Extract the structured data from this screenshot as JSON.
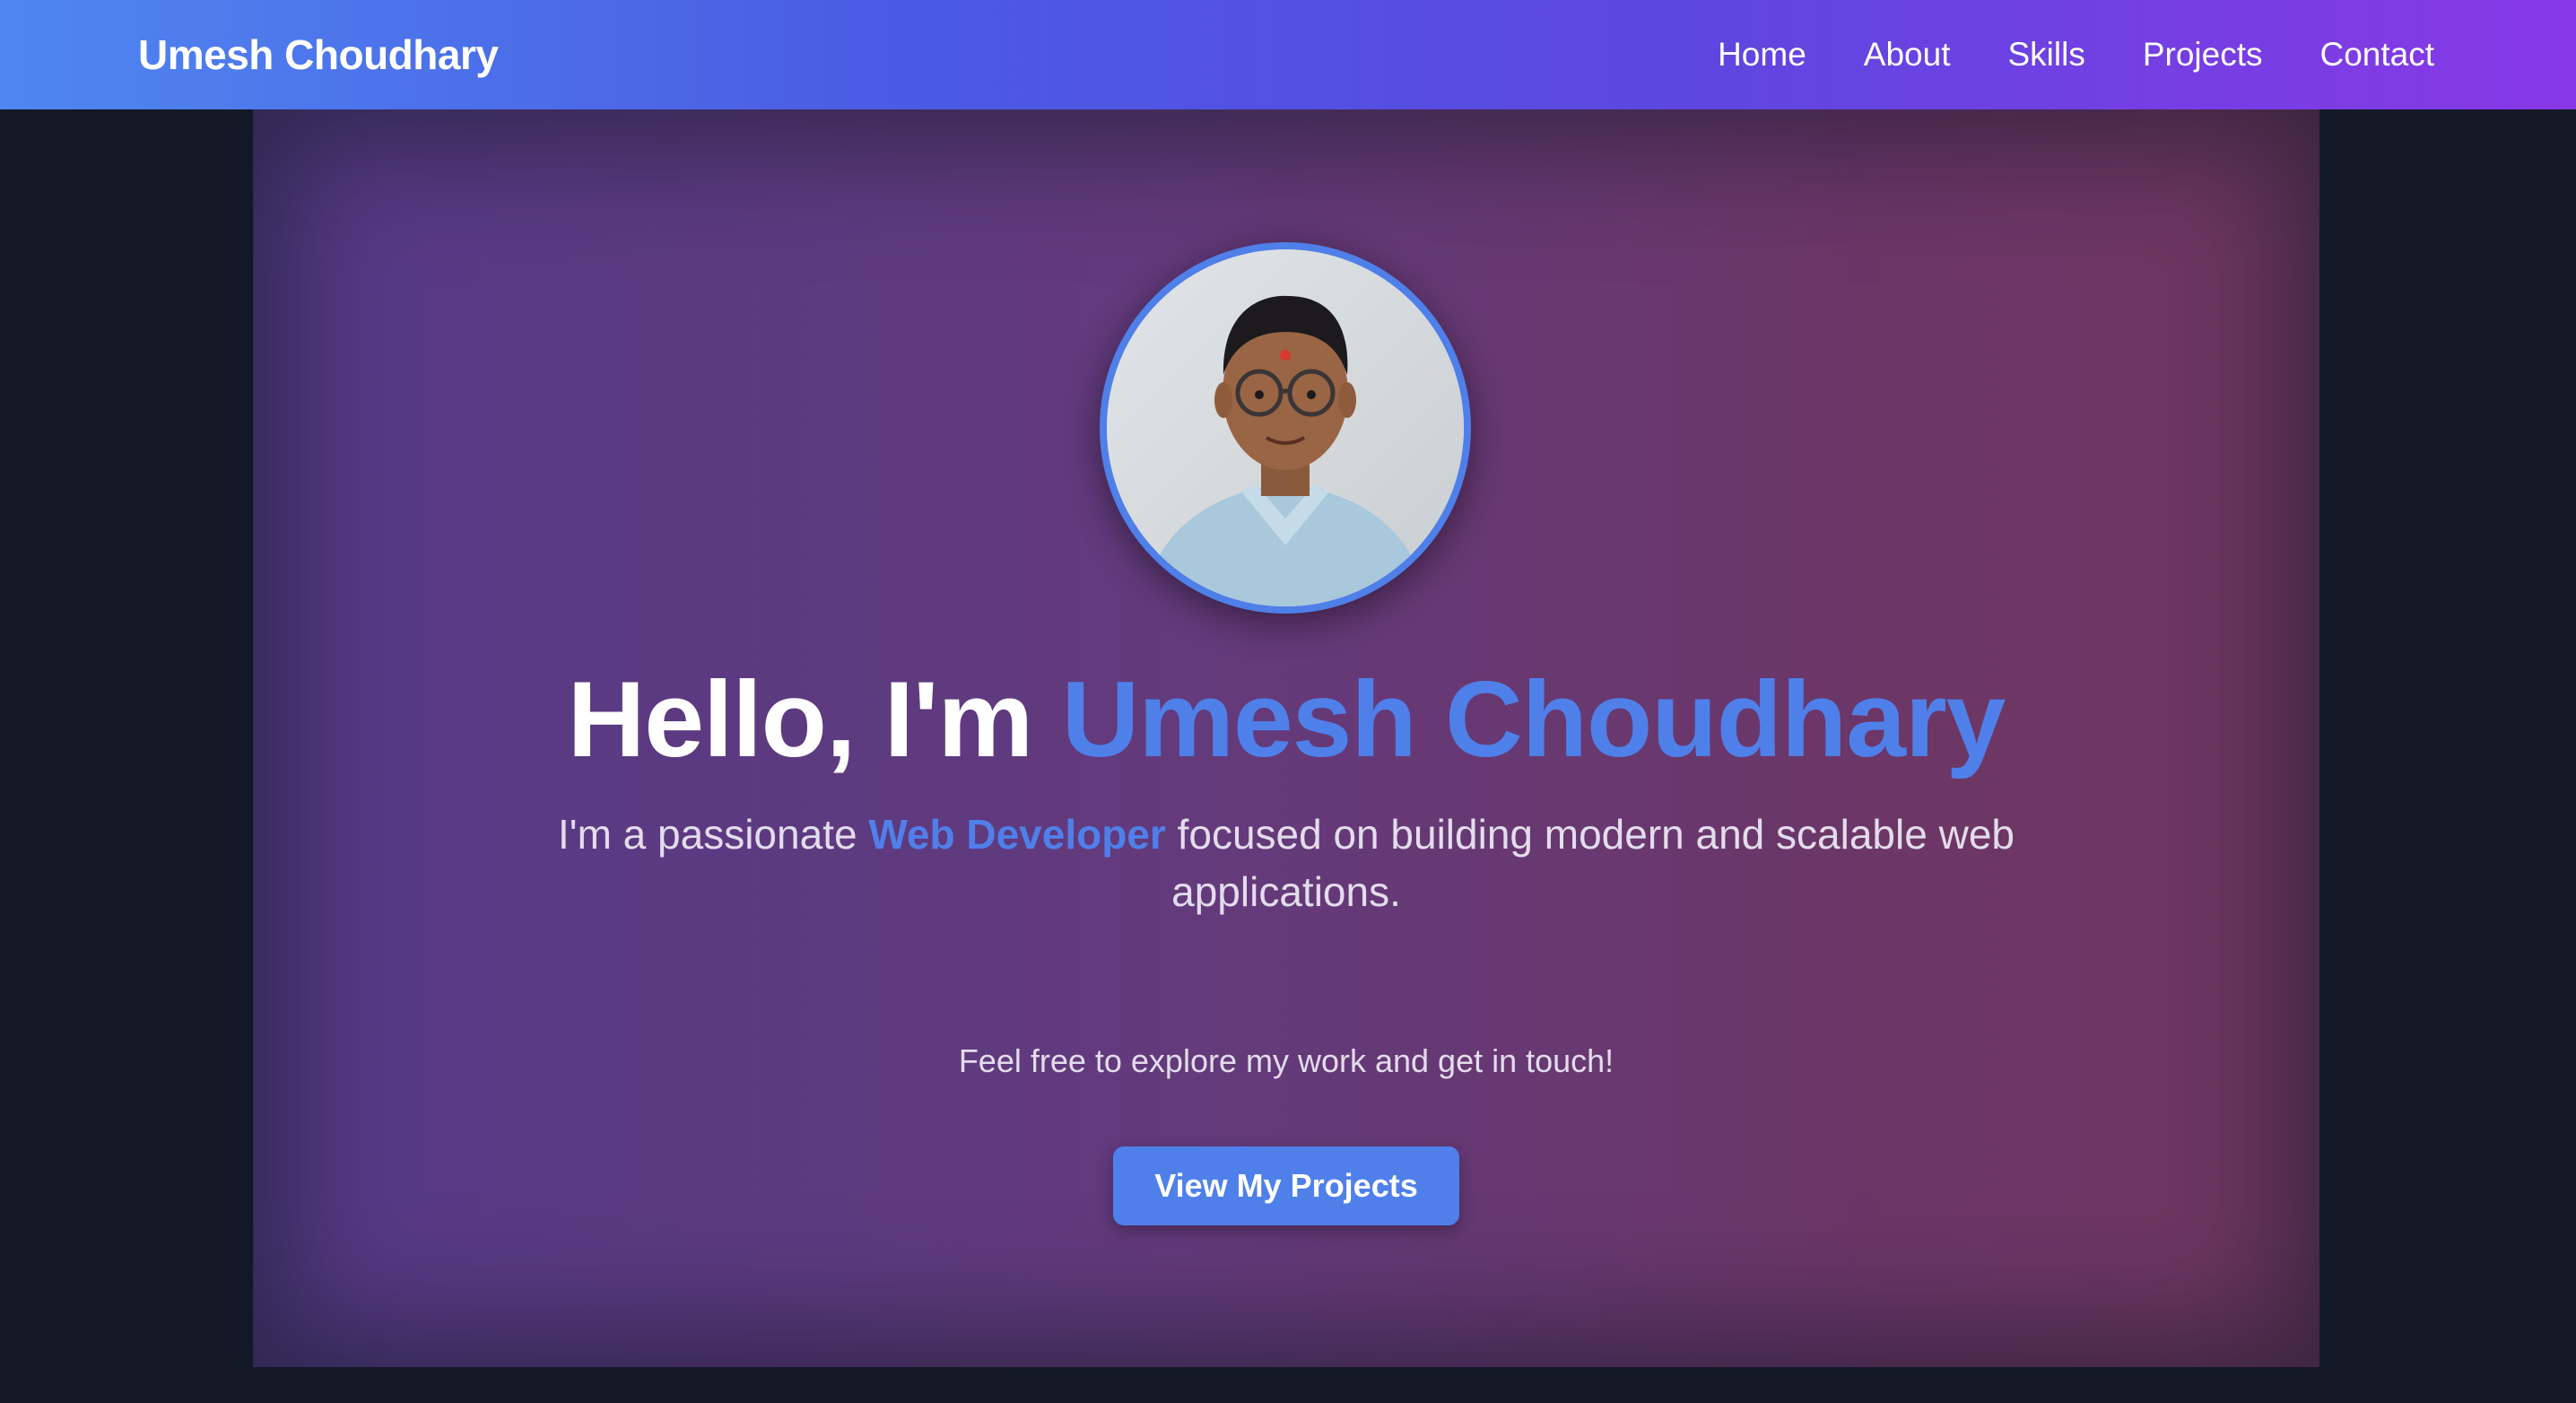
{
  "navbar": {
    "brand": "Umesh Choudhary",
    "links": [
      {
        "label": "Home"
      },
      {
        "label": "About"
      },
      {
        "label": "Skills"
      },
      {
        "label": "Projects"
      },
      {
        "label": "Contact"
      }
    ]
  },
  "hero": {
    "avatar_alt": "profile-photo",
    "greeting": "Hello, I'm ",
    "name": "Umesh Choudhary",
    "tagline_prefix": "I'm a passionate ",
    "tagline_role": "Web Developer",
    "tagline_suffix": " focused on building modern and scalable web applications.",
    "invite": "Feel free to explore my work and get in touch!",
    "cta_label": "View My Projects"
  },
  "colors": {
    "accent": "#4f80ea",
    "page_background": "#121826",
    "navbar_gradient_start": "#4f86f0",
    "navbar_gradient_end": "#8838e6"
  }
}
